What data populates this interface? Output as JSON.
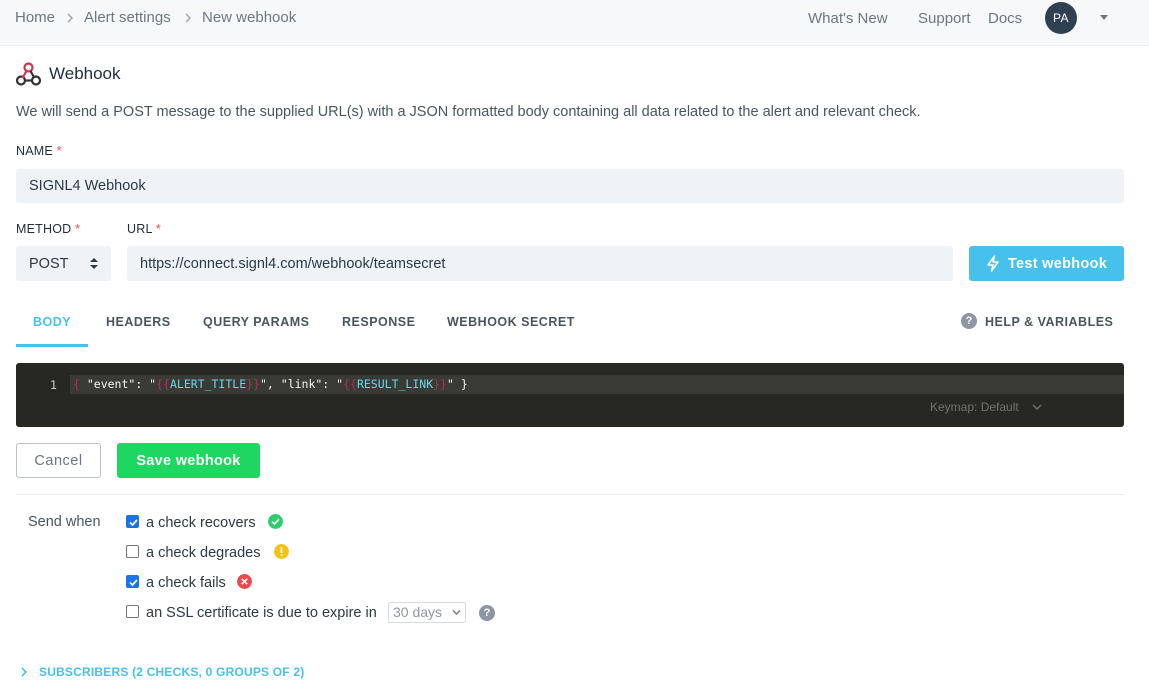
{
  "breadcrumbs": [
    "Home",
    "Alert settings",
    "New webhook"
  ],
  "topnav": {
    "whats_new": "What's New",
    "support": "Support",
    "docs": "Docs",
    "avatar_initials": "PA"
  },
  "header": {
    "title": "Webhook",
    "description": "We will send a POST message to the supplied URL(s) with a JSON formatted body containing all data related to the alert and relevant check."
  },
  "form": {
    "name_label": "NAME",
    "name_value": "SIGNL4 Webhook",
    "method_label": "METHOD",
    "method_value": "POST",
    "url_label": "URL",
    "url_value": "https://connect.signl4.com/webhook/teamsecret",
    "required_mark": "*",
    "test_button": "Test webhook"
  },
  "tabs": [
    "BODY",
    "HEADERS",
    "QUERY PARAMS",
    "RESPONSE",
    "WEBHOOK SECRET"
  ],
  "active_tab": "BODY",
  "help_tab": "HELP & VARIABLES",
  "editor": {
    "line_number": "1",
    "code_parts": [
      "{",
      " \"event\": \"",
      "{{",
      "ALERT_TITLE",
      "}}",
      "\", \"link\": \"",
      "{{",
      "RESULT_LINK",
      "}}",
      "\" }"
    ],
    "keymap": "Keymap: Default"
  },
  "actions": {
    "cancel": "Cancel",
    "save": "Save webhook"
  },
  "send_when": {
    "label": "Send when",
    "options": [
      {
        "label": "a check recovers",
        "checked": true,
        "status": "success"
      },
      {
        "label": "a check degrades",
        "checked": false,
        "status": "warning"
      },
      {
        "label": "a check fails",
        "checked": true,
        "status": "error"
      },
      {
        "label": "an SSL certificate is due to expire in",
        "checked": false,
        "status": ""
      }
    ],
    "expiry_value": "30 days"
  },
  "subscribers": "SUBSCRIBERS (2 CHECKS, 0 GROUPS OF 2)",
  "colors": {
    "accent": "#45c1ec",
    "save": "#1ed760",
    "success": "#2ecc71",
    "warning": "#f5c211",
    "error": "#f0464c"
  }
}
